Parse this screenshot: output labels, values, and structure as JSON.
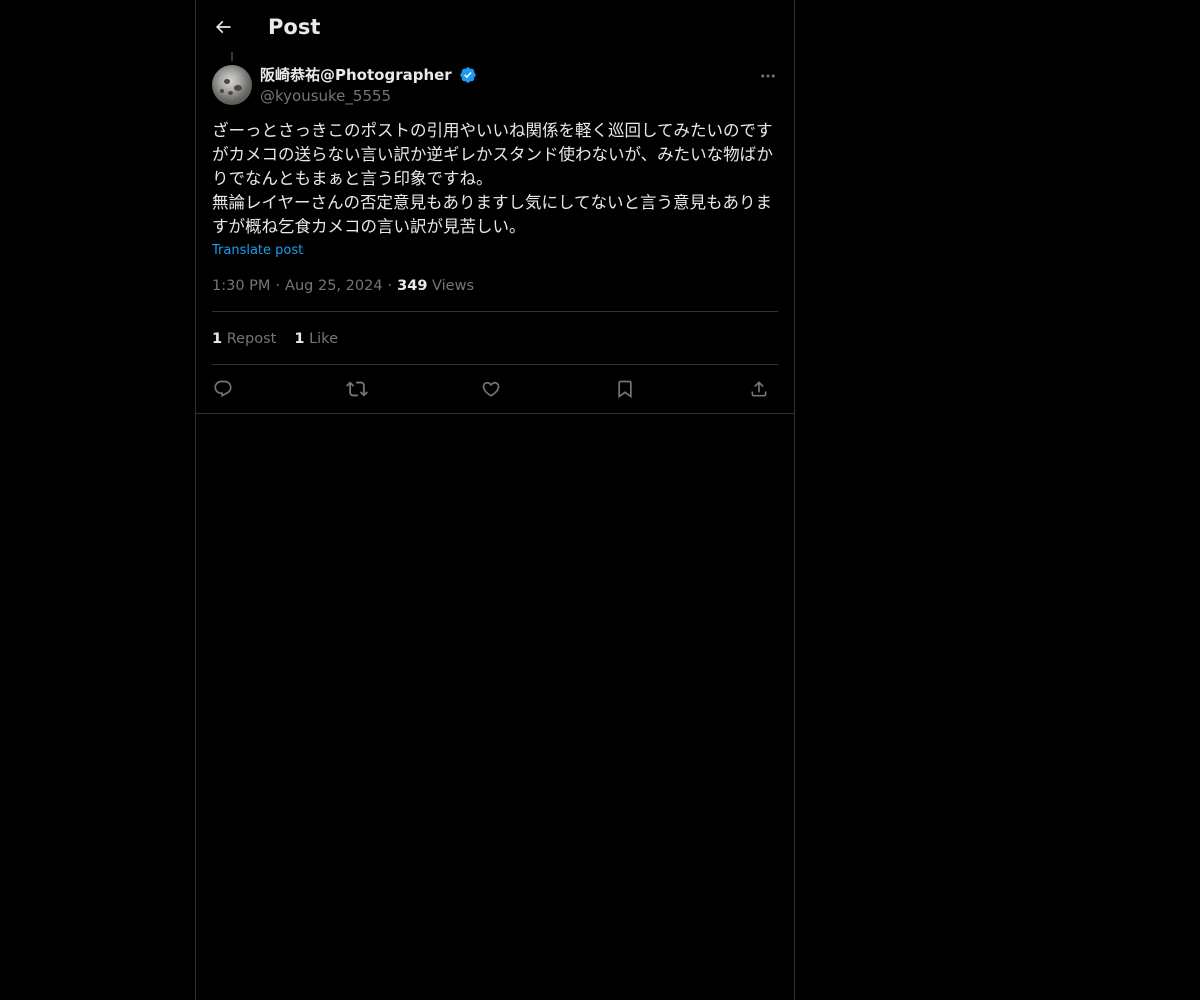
{
  "header": {
    "title": "Post",
    "back_icon": "arrow-left-icon"
  },
  "author": {
    "display_name": "阪崎恭祐@Photographer",
    "handle": "@kyousuke_5555",
    "verified": true,
    "verified_color": "#1d9bf0"
  },
  "post": {
    "text": "ざーっとさっきこのポストの引用やいいね関係を軽く巡回してみたいのですがカメコの送らない言い訳か逆ギレかスタンド使わないが、みたいな物ばかりでなんともまぁと言う印象ですね。\n無論レイヤーさんの否定意見もありますし気にしてないと言う意見もありますが概ね乞食カメコの言い訳が見苦しい。",
    "translate_label": "Translate post",
    "time": "1:30 PM",
    "separator": "·",
    "date": "Aug 25, 2024",
    "views_count": "349",
    "views_label": "Views"
  },
  "stats": {
    "reposts_count": "1",
    "reposts_label": "Repost",
    "likes_count": "1",
    "likes_label": "Like"
  },
  "actions": [
    "reply-icon",
    "repost-icon",
    "like-icon",
    "bookmark-icon",
    "share-icon"
  ],
  "colors": {
    "background": "#000000",
    "text_primary": "#e7e9ea",
    "text_secondary": "#71767b",
    "border": "#2f3336",
    "link": "#1d9bf0"
  }
}
